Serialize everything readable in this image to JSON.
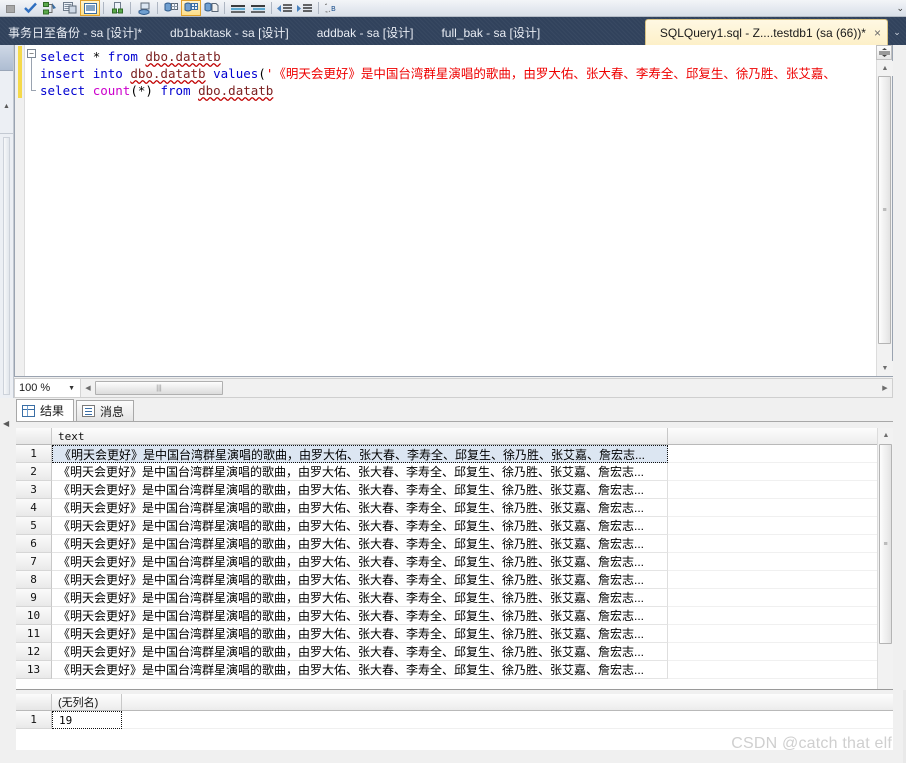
{
  "toolbar": {
    "buttons": [
      {
        "name": "stop-icon",
        "glyph": "■",
        "state": "disabled"
      },
      {
        "name": "check-parse-icon",
        "glyph": "✔",
        "state": "normal"
      },
      {
        "name": "display-estimated-plan-icon",
        "glyph": "⎇",
        "state": "normal"
      },
      {
        "name": "query-options-icon",
        "glyph": "▤",
        "state": "normal"
      },
      {
        "name": "include-actual-plan-icon",
        "glyph": "≣",
        "state": "toggled-on"
      },
      {
        "name": "include-client-statistics-icon",
        "glyph": "↥",
        "state": "normal"
      },
      {
        "name": "results-to-text-icon",
        "glyph": "☰",
        "state": "normal"
      },
      {
        "name": "results-to-grid-icon",
        "glyph": "▦",
        "state": "normal"
      },
      {
        "name": "results-to-grid-active-icon",
        "glyph": "▩",
        "state": "toggled-on"
      },
      {
        "name": "results-to-file-icon",
        "glyph": "❑",
        "state": "normal"
      },
      {
        "name": "comment-lines-icon",
        "glyph": "≡",
        "state": "normal"
      },
      {
        "name": "uncomment-lines-icon",
        "glyph": "≡",
        "state": "normal"
      },
      {
        "name": "decrease-indent-icon",
        "glyph": "⇤",
        "state": "normal"
      },
      {
        "name": "increase-indent-icon",
        "glyph": "⇥",
        "state": "normal"
      },
      {
        "name": "specify-values-icon",
        "glyph": "⁂",
        "state": "normal"
      }
    ],
    "overflow_label": "⌄"
  },
  "tabs": [
    {
      "title": "事务日至备份 - sa [设计]*",
      "active": false
    },
    {
      "title": "db1baktask - sa [设计]",
      "active": false
    },
    {
      "title": "addbak - sa [设计]",
      "active": false
    },
    {
      "title": "full_bak - sa [设计]",
      "active": false
    }
  ],
  "active_tab": {
    "title": "SQLQuery1.sql - Z....testdb1 (sa (66))*",
    "close_label": "×"
  },
  "tabstrip_menu_label": "⌄",
  "editor": {
    "outline_collapse_glyph": "−",
    "lines": [
      {
        "n": 1,
        "tokens": [
          {
            "t": "select",
            "c": "kw"
          },
          {
            "t": " ",
            "c": "plain"
          },
          {
            "t": "*",
            "c": "plain"
          },
          {
            "t": " ",
            "c": "plain"
          },
          {
            "t": "from",
            "c": "kw"
          },
          {
            "t": "  ",
            "c": "plain"
          },
          {
            "t": "dbo.datatb",
            "c": "obj"
          }
        ]
      },
      {
        "n": 2,
        "tokens": [
          {
            "t": "insert",
            "c": "kw"
          },
          {
            "t": " ",
            "c": "plain"
          },
          {
            "t": "into",
            "c": "kw"
          },
          {
            "t": " ",
            "c": "plain"
          },
          {
            "t": "dbo.datatb",
            "c": "obj"
          },
          {
            "t": " ",
            "c": "plain"
          },
          {
            "t": "values",
            "c": "kw"
          },
          {
            "t": "(",
            "c": "plain"
          },
          {
            "t": "'《明天会更好》是中国台湾群星演唱的歌曲，由罗大佑、张大春、李寿全、邱复生、徐乃胜、张艾嘉、",
            "c": "str"
          }
        ]
      },
      {
        "n": 3,
        "tokens": [
          {
            "t": "select",
            "c": "kw"
          },
          {
            "t": " ",
            "c": "plain"
          },
          {
            "t": "count",
            "c": "fn"
          },
          {
            "t": "(*)",
            "c": "plain"
          },
          {
            "t": " ",
            "c": "plain"
          },
          {
            "t": "from",
            "c": "kw"
          },
          {
            "t": "  ",
            "c": "plain"
          },
          {
            "t": "dbo.datatb",
            "c": "obj"
          }
        ]
      }
    ]
  },
  "zoombar": {
    "zoom_level": "100 %",
    "caret": "▼",
    "scroll_left_arrow": "◀",
    "scroll_right_arrow": "▶",
    "thumb_grip": "|||"
  },
  "result_tabs": [
    {
      "label": "结果",
      "icon": "results-grid-icon",
      "active": true
    },
    {
      "label": "消息",
      "icon": "messages-icon",
      "active": false
    }
  ],
  "grid1": {
    "columns": [
      "text"
    ],
    "row_text": "《明天会更好》是中国台湾群星演唱的歌曲，由罗大佑、张大春、李寿全、邱复生、徐乃胜、张艾嘉、詹宏志...",
    "rows": [
      {
        "num": "1",
        "selected": true
      },
      {
        "num": "2",
        "selected": false
      },
      {
        "num": "3",
        "selected": false
      },
      {
        "num": "4",
        "selected": false
      },
      {
        "num": "5",
        "selected": false
      },
      {
        "num": "6",
        "selected": false
      },
      {
        "num": "7",
        "selected": false
      },
      {
        "num": "8",
        "selected": false
      },
      {
        "num": "9",
        "selected": false
      },
      {
        "num": "10",
        "selected": false
      },
      {
        "num": "11",
        "selected": false
      },
      {
        "num": "12",
        "selected": false
      },
      {
        "num": "13",
        "selected": false
      }
    ]
  },
  "grid2": {
    "columns": [
      "(无列名)"
    ],
    "rows": [
      {
        "num": "1",
        "value": "19"
      }
    ]
  },
  "scrollbars": {
    "up_arrow": "▲",
    "down_arrow": "▼",
    "grip": "≡",
    "split_handle": "➕"
  },
  "watermark": "CSDN @catch that elf",
  "colors": {
    "tabstrip_bg": "#31425c",
    "active_tab_bg": "#fdf0c8",
    "keyword": "#0000d0",
    "string": "#ee0000",
    "function": "#cc00cc",
    "object": "#7b1f1f",
    "selection": "#dce6f2",
    "changebar": "#f5d94a"
  }
}
